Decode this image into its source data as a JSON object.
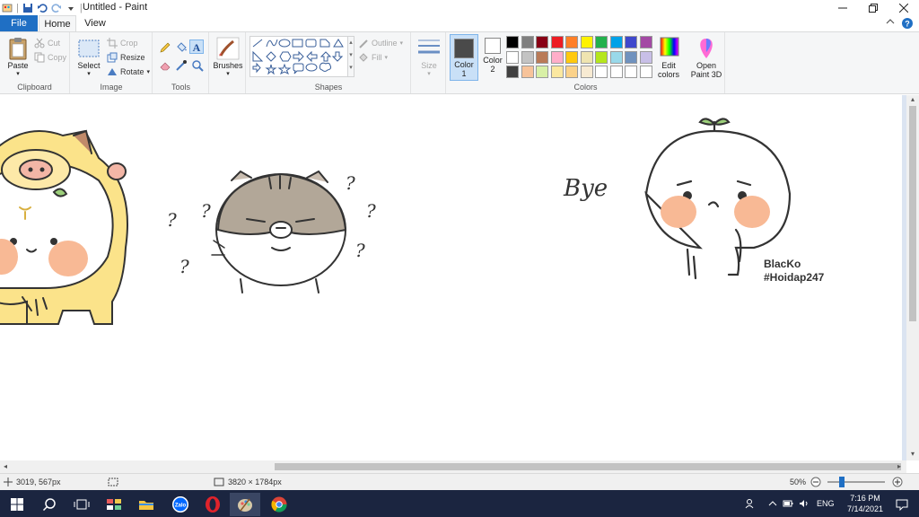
{
  "title_bar": {
    "title": "Untitled - Paint",
    "qa_separator": "|"
  },
  "tabs": [
    {
      "label": "File"
    },
    {
      "label": "Home"
    },
    {
      "label": "View"
    }
  ],
  "clipboard": {
    "paste_label": "Paste",
    "cut_label": "Cut",
    "copy_label": "Copy",
    "group_label": "Clipboard"
  },
  "image": {
    "select_label": "Select",
    "crop_label": "Crop",
    "resize_label": "Resize",
    "rotate_label": "Rotate",
    "group_label": "Image"
  },
  "tools": {
    "group_label": "Tools",
    "brushes_label": "Brushes"
  },
  "shapes": {
    "outline_label": "Outline",
    "fill_label": "Fill",
    "group_label": "Shapes"
  },
  "size": {
    "label": "Size"
  },
  "colors": {
    "color1_label": "Color",
    "color1_num": "1",
    "color2_label": "Color",
    "color2_num": "2",
    "color1_value": "#4a4a4a",
    "color2_value": "#ffffff",
    "group_label": "Colors",
    "edit_colors_label": "Edit colors",
    "open_paint3d_label": "Open Paint 3D",
    "palette": [
      "#000000",
      "#7f7f7f",
      "#880015",
      "#ed1c24",
      "#ff7f27",
      "#fff200",
      "#22b14c",
      "#00a2e8",
      "#3f48cc",
      "#a349a4",
      "#ffffff",
      "#c3c3c3",
      "#b97a57",
      "#ffaec9",
      "#ffc90e",
      "#efe4b0",
      "#b5e61d",
      "#99d9ea",
      "#7092be",
      "#c8bfe7",
      "#404040",
      "#f7c39a",
      "#d8f0a6",
      "#fbe8a0",
      "#fbd28a",
      "#f7ead2",
      "#ffffff",
      "#ffffff",
      "#ffffff",
      "#ffffff"
    ]
  },
  "canvas": {
    "text_bye": "Bye",
    "text_name": "BlacKo",
    "text_tag": "#Hoidap247",
    "question_mark": "?"
  },
  "status": {
    "cursor_pos": "3019, 567px",
    "image_size": "3820 × 1784px",
    "zoom": "50%"
  },
  "taskbar": {
    "lang": "ENG",
    "time": "7:16 PM",
    "date": "7/14/2021",
    "zalo_label": "Zalo"
  }
}
